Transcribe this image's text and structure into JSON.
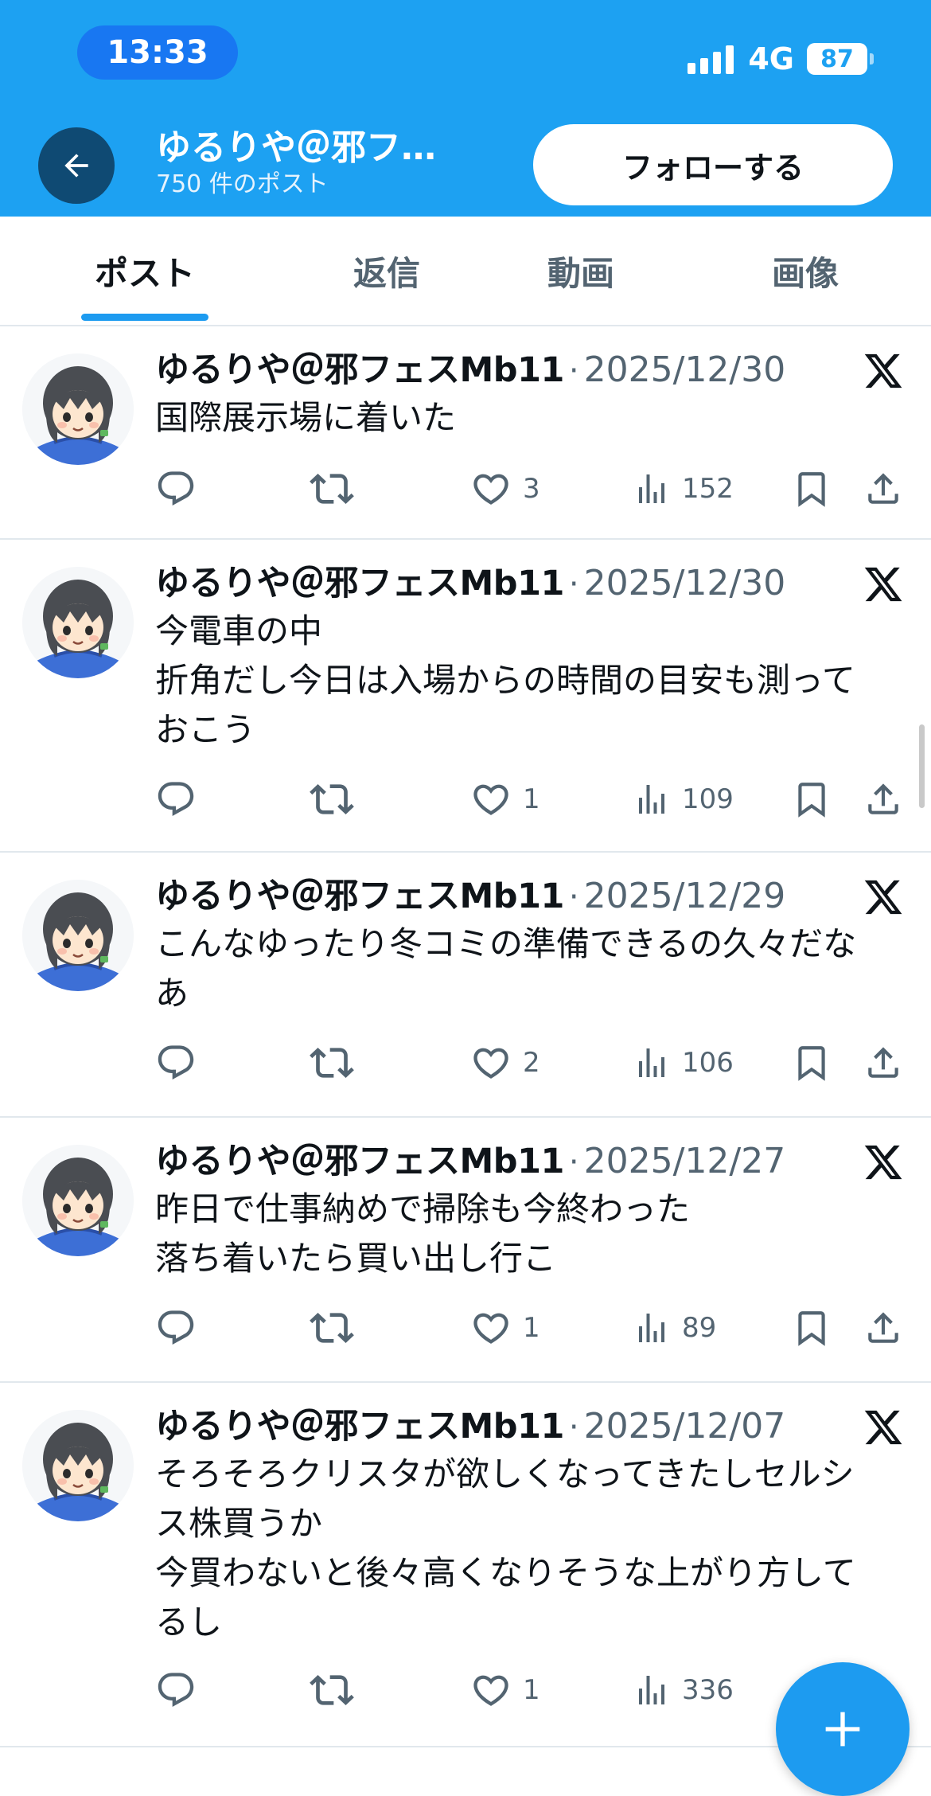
{
  "status_bar": {
    "time": "13:33",
    "network": "4G",
    "battery": "87"
  },
  "header": {
    "back_icon": "arrow-left-icon",
    "title": "ゆるりや＠邪フ…",
    "subtitle": "750 件のポスト",
    "follow_label": "フォローする"
  },
  "tabs": [
    {
      "label": "ポスト",
      "active": true
    },
    {
      "label": "返信",
      "active": false
    },
    {
      "label": "動画",
      "active": false
    },
    {
      "label": "画像",
      "active": false
    }
  ],
  "posts": [
    {
      "name": "ゆるりや＠邪フェスMb11",
      "date": "2025/12/30",
      "lines": [
        "国際展示場に着いた"
      ],
      "likes": "3",
      "views": "152"
    },
    {
      "name": "ゆるりや＠邪フェスMb11",
      "date": "2025/12/30",
      "lines": [
        "今電車の中",
        "折角だし今日は入場からの時間の目安も測って",
        "おこう"
      ],
      "likes": "1",
      "views": "109"
    },
    {
      "name": "ゆるりや＠邪フェスMb11",
      "date": "2025/12/29",
      "lines": [
        "こんなゆったり冬コミの準備できるの久々だな",
        "あ"
      ],
      "likes": "2",
      "views": "106"
    },
    {
      "name": "ゆるりや＠邪フェスMb11",
      "date": "2025/12/27",
      "lines": [
        "昨日で仕事納めで掃除も今終わった",
        "落ち着いたら買い出し行こ"
      ],
      "likes": "1",
      "views": "89"
    },
    {
      "name": "ゆるりや＠邪フェスMb11",
      "date": "2025/12/07",
      "lines": [
        "そろそろクリスタが欲しくなってきたしセルシ",
        "ス株買うか",
        "今買わないと後々高くなりそうな上がり方して",
        "るし"
      ],
      "likes": "1",
      "views": "336"
    }
  ],
  "post_separator": "·",
  "icons": {
    "reply": "reply-icon",
    "repost": "repost-icon",
    "like": "heart-icon",
    "views": "views-icon",
    "bookmark": "bookmark-icon",
    "share": "share-icon",
    "source": "x-logo-icon",
    "compose": "plus-icon"
  },
  "colors": {
    "header_bg": "#1da1f2",
    "accent": "#1d9bf0",
    "text_secondary": "#536471"
  }
}
